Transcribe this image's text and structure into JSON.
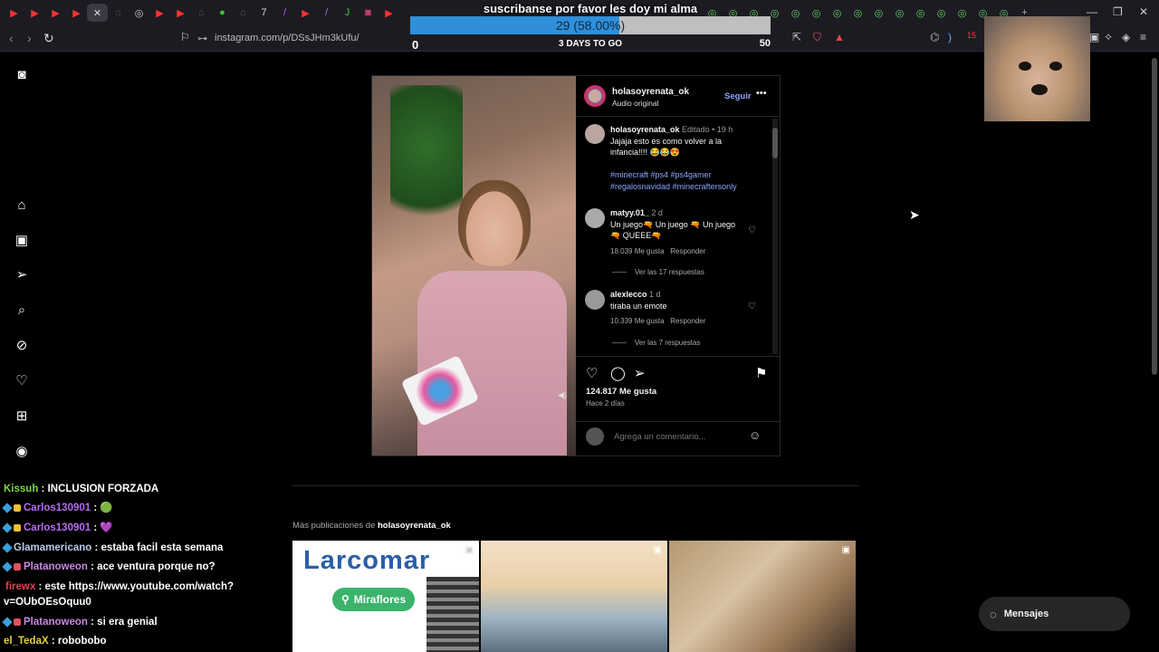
{
  "browser": {
    "url": "instagram.com/p/DSsJHm3kUfu/",
    "tab_icons": [
      "youtube",
      "youtube",
      "youtube",
      "x",
      "bag",
      "globe",
      "youtube",
      "youtube",
      "bag",
      "green",
      "bag",
      "7",
      "pen",
      "youtube",
      "pen",
      "j",
      "instagram",
      "youtube"
    ],
    "extension_count": "15"
  },
  "stream_goal": {
    "title": "suscribanse por favor les doy mi alma",
    "progress_text": "29 (58.00%)",
    "progress_fraction": 0.58,
    "min": "0",
    "max": "50",
    "days": "3 DAYS TO GO"
  },
  "post": {
    "username": "holasoyrenata_ok",
    "audio": "Audio original",
    "follow_label": "Seguir",
    "caption": {
      "user": "holasoyrenata_ok",
      "meta": "Editado • 19 h",
      "text": "Jajaja esto es como volver a la infancia!!!! 😂😂😍",
      "tags": "#minecraft #ps4 #ps4gamer #regalosnavidad #minecraftersonly"
    },
    "comments": [
      {
        "user": "matyy.01_",
        "time": "2 d",
        "text": "Un juego🔫 Un juego 🔫 Un juego 🔫 QUEEE🔫",
        "likes": "18.039 Me gusta",
        "reply": "Responder",
        "replies": "Ver las 17 respuestas"
      },
      {
        "user": "alexlecco",
        "time": "1 d",
        "text": "tiraba un emote",
        "likes": "10.339 Me gusta",
        "reply": "Responder",
        "replies": "Ver las 7 respuestas"
      }
    ],
    "likes": "124.817 Me gusta",
    "when": "Hace 2 días",
    "comment_placeholder": "Agrega un comentario..."
  },
  "more": {
    "prefix": "Más publicaciones de",
    "user": "holasoyrenata_ok",
    "thumb1_word": "Larcomar",
    "thumb1_badge": "Miraflores"
  },
  "chat": [
    {
      "user": "Kissuh",
      "color": "#7bd64b",
      "text": "INCLUSION FORZADA"
    },
    {
      "user": "Carlos130901",
      "color": "#b56cf0",
      "text": "🟢"
    },
    {
      "user": "Carlos130901",
      "color": "#b56cf0",
      "text": "💜"
    },
    {
      "user": "Glamamericano",
      "color": "#b9c9e9",
      "text": "estaba facil esta semana"
    },
    {
      "user": "Platanoweon",
      "color": "#c889e0",
      "text": "ace ventura porque no?"
    },
    {
      "user": "firewx",
      "color": "#e04050",
      "text": "este https://www.youtube.com/watch?v=OUbOEsOquu0"
    },
    {
      "user": "Platanoweon",
      "color": "#c889e0",
      "text": "si era genial"
    },
    {
      "user": "el_TedaX",
      "color": "#e0d040",
      "text": "robobobo"
    }
  ],
  "messages_label": "Mensajes"
}
